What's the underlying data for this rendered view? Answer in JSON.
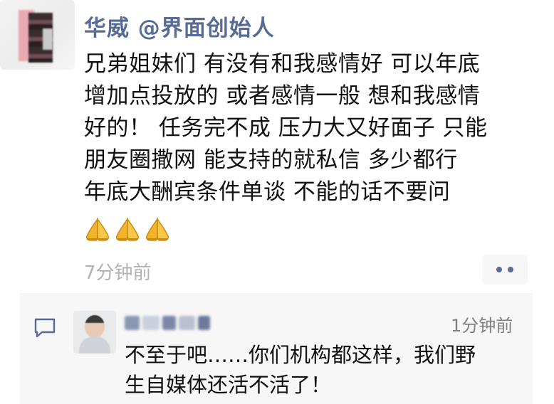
{
  "post": {
    "author": "华威 @界面创始人",
    "text_lines": [
      "兄弟姐妹们 有没有和我感情好 可以年底",
      "增加点投放的 或者感情一般 想和我感情",
      "好的！ 任务完不成 压力大又好面子 只能",
      "朋友圈撒网 能支持的就私信 多少都行",
      "年底大酬宾条件单谈 不能的话不要问"
    ],
    "emojis": [
      "praying-hands-emoji",
      "praying-hands-emoji",
      "praying-hands-emoji"
    ],
    "timestamp": "7分钟前",
    "more_button_icon": "more-dots-icon"
  },
  "comment": {
    "icon": "comment-bubble-icon",
    "time": "1分钟前",
    "text_lines": [
      "不至于吧……你们机构都这样，我们野",
      "生自媒体还活不活了！"
    ]
  },
  "colors": {
    "link_blue": "#576b95",
    "text": "#111111",
    "meta_gray": "#b2b2b2",
    "comment_bg": "#f7f7f7",
    "emoji_gold": "#f2b52a"
  }
}
